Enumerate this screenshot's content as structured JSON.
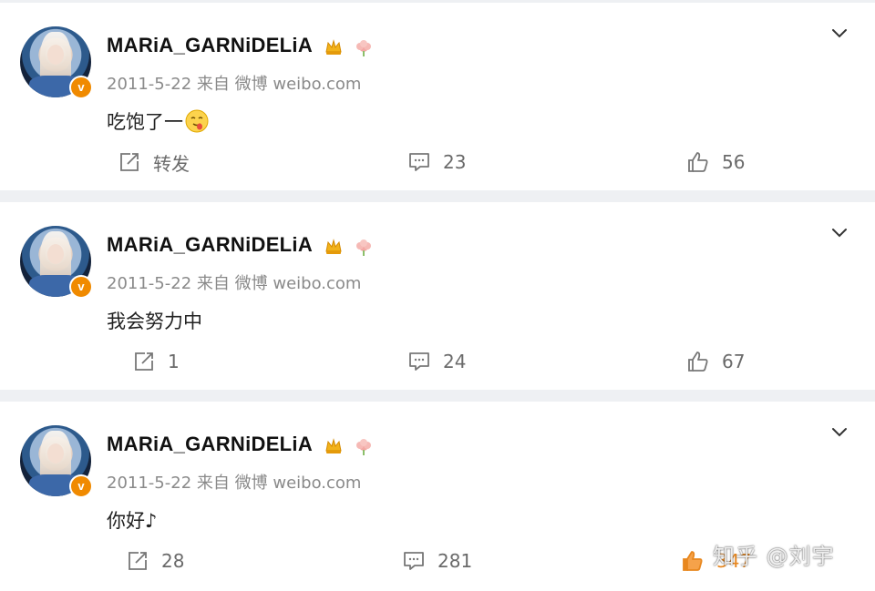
{
  "posts": [
    {
      "username": "MARiA_GARNiDELiA",
      "date": "2011-5-22",
      "source_prefix": "来自",
      "source": "微博 weibo.com",
      "content": "吃饱了一",
      "content_emoji": "yum-face-emoji",
      "share_label": "转发",
      "comments": "23",
      "likes": "56"
    },
    {
      "username": "MARiA_GARNiDELiA",
      "date": "2011-5-22",
      "source_prefix": "来自",
      "source": "微博 weibo.com",
      "content": "我会努力中",
      "share_label": "1",
      "comments": "24",
      "likes": "67"
    },
    {
      "username": "MARiA_GARNiDELiA",
      "date": "2011-5-22",
      "source_prefix": "来自",
      "source": "微博 weibo.com",
      "content": "你好♪",
      "share_label": "28",
      "comments": "281",
      "likes": "347"
    }
  ],
  "verified_badge": "v",
  "watermark": "知乎 @刘宇",
  "colors": {
    "username": "#111111",
    "meta": "#8a8a8a",
    "action": "#6a6a6a",
    "liked": "#e8871e",
    "verified": "#f08a00",
    "divider": "#eef0f3"
  }
}
